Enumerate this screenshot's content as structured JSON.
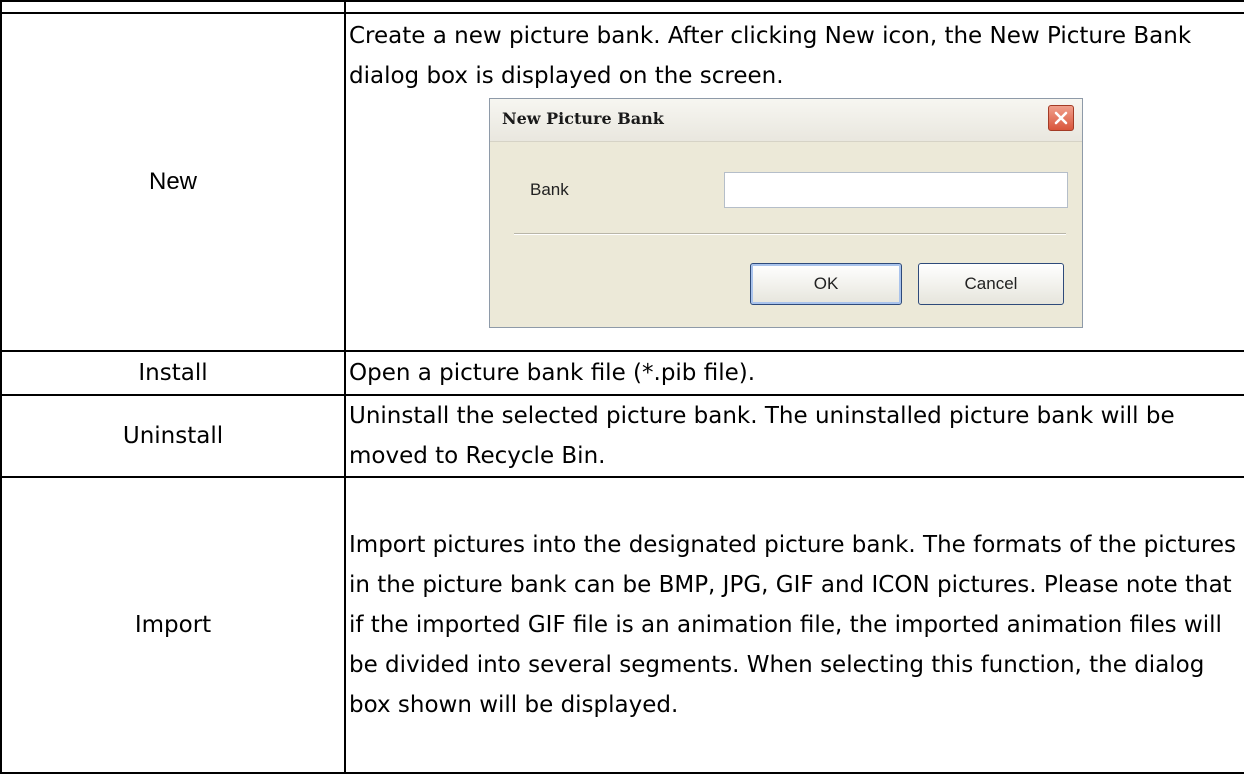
{
  "rows": [
    {
      "label": "New",
      "description": "Create a new picture bank. After clicking New icon, the New Picture Bank dialog box is displayed on the screen."
    },
    {
      "label": "Install",
      "description": "Open a picture bank file (*.pib file)."
    },
    {
      "label": "Uninstall",
      "description": "Uninstall the selected picture bank. The uninstalled picture bank will be moved to Recycle Bin."
    },
    {
      "label": "Import",
      "description": "Import pictures into the designated picture bank. The formats of the pictures in the picture bank can be BMP, JPG, GIF and ICON pictures. Please note that if the imported GIF file is an animation file, the imported animation files will be divided into several segments. When selecting this function, the dialog box shown will be displayed."
    }
  ],
  "dialog": {
    "title": "New Picture Bank",
    "field_label": "Bank",
    "field_value": "",
    "ok_label": "OK",
    "cancel_label": "Cancel",
    "close_icon": "close-icon"
  }
}
